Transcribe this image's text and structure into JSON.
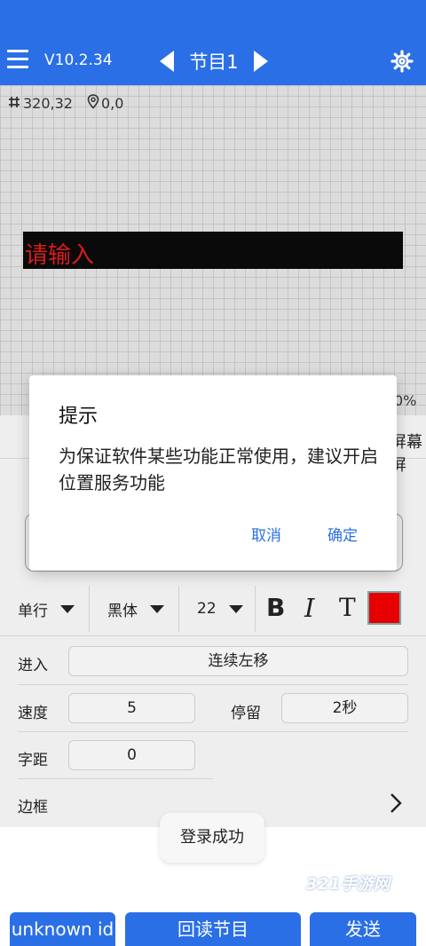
{
  "app": {
    "version": "V10.2.34",
    "program_title": "节目1",
    "accent_color": "#2a6fe6"
  },
  "canvas": {
    "size_readout": "320,32",
    "position_readout": "0,0",
    "led_text": "请输入",
    "led_text_color": "#d81c1c",
    "right_fragment": "0%"
  },
  "panel": {
    "header_fragment": "屏幕屏",
    "format": {
      "line_mode": "单行",
      "font": "黑体",
      "font_size": "22",
      "bold_label": "B",
      "italic_label": "I",
      "text_tool_label": "T",
      "text_color": "#e60000"
    },
    "enter_label": "进入",
    "enter_value": "连续左移",
    "speed_label": "速度",
    "speed_value": "5",
    "stay_label": "停留",
    "stay_value": "2秒",
    "spacing_label": "字距",
    "spacing_value": "0",
    "border_label": "边框"
  },
  "toast": "登录成功",
  "watermark": "321手游网",
  "bottom_bar": {
    "left_button": "unknown id",
    "middle_button": "回读节目",
    "right_button": "发送"
  },
  "dialog": {
    "title": "提示",
    "message": "为保证软件某些功能正常使用，建议开启位置服务功能",
    "cancel": "取消",
    "ok": "确定"
  },
  "icons": [
    "menu-icon",
    "chevron-left-icon",
    "chevron-right-icon",
    "gear-icon",
    "grid-hash-icon",
    "location-pin-icon",
    "chevron-right-icon"
  ]
}
